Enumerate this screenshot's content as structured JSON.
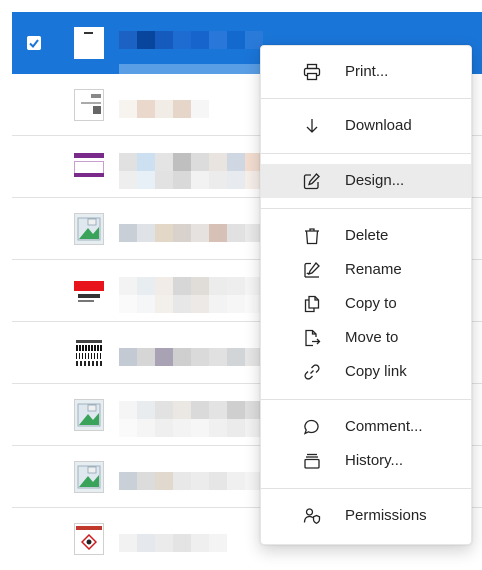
{
  "context_menu": {
    "items": [
      {
        "label": "Print...",
        "icon": "printer-icon"
      },
      {
        "label": "Download",
        "icon": "download-icon"
      },
      {
        "label": "Design...",
        "icon": "edit-icon"
      },
      {
        "label": "Delete",
        "icon": "trash-icon"
      },
      {
        "label": "Rename",
        "icon": "rename-icon"
      },
      {
        "label": "Copy to",
        "icon": "copy-icon"
      },
      {
        "label": "Move to",
        "icon": "move-icon"
      },
      {
        "label": "Copy link",
        "icon": "link-icon"
      },
      {
        "label": "Comment...",
        "icon": "comment-icon"
      },
      {
        "label": "History...",
        "icon": "history-icon"
      },
      {
        "label": "Permissions",
        "icon": "permissions-icon"
      }
    ]
  },
  "colors": {
    "selection": "#1a75d8",
    "hover": "#ebebeb"
  }
}
